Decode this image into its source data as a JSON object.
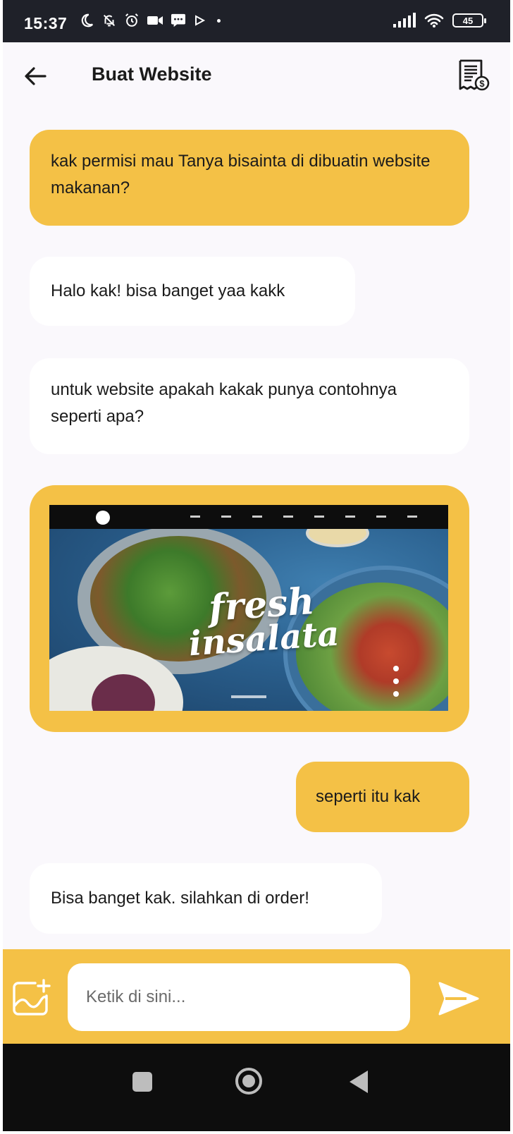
{
  "status_bar": {
    "time": "15:37",
    "battery": "45",
    "left_icons": [
      "moon-icon",
      "bell-off-icon",
      "alarm-icon",
      "video-icon",
      "message-icon",
      "play-icon",
      "dot-icon"
    ],
    "right_icons": [
      "signal-icon",
      "wifi-icon",
      "battery-icon"
    ]
  },
  "app_bar": {
    "title": "Buat Website",
    "back_icon": "arrow-left-icon",
    "action_icon": "invoice-icon"
  },
  "messages": [
    {
      "type": "sent",
      "text": "kak permisi mau Tanya bisainta di dibuatin website makanan?"
    },
    {
      "type": "received",
      "text": "Halo kak! bisa banget yaa kakk"
    },
    {
      "type": "received",
      "text": "untuk website apakah kakak punya contohnya seperti apa?"
    },
    {
      "type": "sent-image",
      "image": {
        "title_line1": "fresh",
        "title_line2": "insalata"
      }
    },
    {
      "type": "sent",
      "text": "seperti itu kak"
    },
    {
      "type": "received",
      "text": "Bisa banget kak. silahkan di order!"
    }
  ],
  "input": {
    "placeholder": "Ketik di sini...",
    "attach_icon": "add-image-icon",
    "send_icon": "send-icon"
  },
  "colors": {
    "accent": "#f4c146",
    "background": "#faf8fc",
    "bubble_received": "#ffffff",
    "status_bar": "#1f2129",
    "nav_bar": "#0d0d0d"
  },
  "nav_bar": {
    "icons": [
      "recent-apps-icon",
      "home-icon",
      "back-icon"
    ]
  }
}
